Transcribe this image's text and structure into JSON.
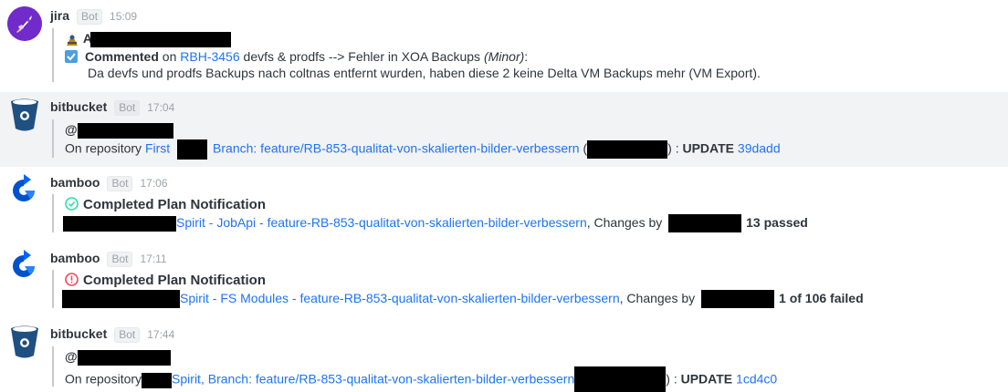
{
  "messages": [
    {
      "username": "jira",
      "bot_label": "Bot",
      "time": "15:09",
      "icon": "rocket-avatar-icon",
      "redacted_prefix": "A",
      "action": "Commented",
      "on_word": "on",
      "issue_key": "RBH-3456",
      "issue_title": " devfs & prodfs --> Fehler in XOA Backups ",
      "priority": "(Minor)",
      "colon": ":",
      "comment": "Da devfs und prodfs Backups nach coltnas entfernt wurden, haben diese 2 keine Delta VM Backups mehr (VM Export)."
    },
    {
      "username": "bitbucket",
      "bot_label": "Bot",
      "time": "17:04",
      "icon": "bitbucket-bucket-icon",
      "at": "@",
      "repo_prefix": "On repository ",
      "repo_link": "First ",
      "branch_link": "Branch: feature/RB-853-qualitat-von-skalierten-bilder-verbessern",
      "paren_open": " (",
      "paren_close": ") : ",
      "update": "UPDATE",
      "commit": "39dadd"
    },
    {
      "username": "bamboo",
      "bot_label": "Bot",
      "time": "17:06",
      "icon": "bamboo-avatar-icon",
      "status_icon": "check-circle-icon",
      "title": "Completed Plan Notification",
      "plan_link": "Spirit - JobApi - feature-RB-853-qualitat-von-skalierten-bilder-verbessern",
      "changes": ", Changes by ",
      "result": "13 passed"
    },
    {
      "username": "bamboo",
      "bot_label": "Bot",
      "time": "17:11",
      "icon": "bamboo-avatar-icon",
      "status_icon": "error-circle-icon",
      "title": "Completed Plan Notification",
      "plan_link": "Spirit - FS Modules - feature-RB-853-qualitat-von-skalierten-bilder-verbessern",
      "changes": ", Changes by ",
      "result": "1 of 106 failed"
    },
    {
      "username": "bitbucket",
      "bot_label": "Bot",
      "time": "17:44",
      "icon": "bitbucket-bucket-icon",
      "at": "@",
      "repo_prefix": "On repository",
      "repo_link": "Spirit, ",
      "branch_link": "Branch: feature/RB-853-qualitat-von-skalierten-bilder-verbessern",
      "paren_close": ") : ",
      "update": "UPDATE",
      "commit": "1cd4c0"
    }
  ],
  "colors": {
    "link": "#1d74f5",
    "bitbucket": "#205081",
    "bamboo": "#0052cc",
    "success": "#2de0a5",
    "error": "#f5455c",
    "jira_avatar": "#7b2bd9"
  }
}
